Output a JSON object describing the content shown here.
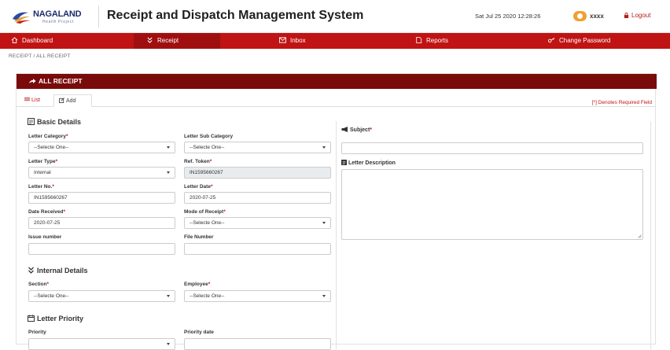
{
  "header": {
    "logo_name": "NAGALAND",
    "logo_sub": "Health Project",
    "title": "Receipt and Dispatch Management System",
    "datetime": "Sat Jul 25 2020 12:28:26",
    "user": "xxxx",
    "logout": "Logout"
  },
  "nav": {
    "items": [
      {
        "label": "Dashboard",
        "icon": "home-icon"
      },
      {
        "label": "Receipt",
        "icon": "chevrons-down-icon"
      },
      {
        "label": "Inbox",
        "icon": "envelope-icon"
      },
      {
        "label": "Reports",
        "icon": "document-icon"
      },
      {
        "label": "Change Password",
        "icon": "key-icon"
      }
    ],
    "active": "Receipt"
  },
  "breadcrumb": "RECEIPT  /  ALL RECEIPT",
  "card": {
    "title": "ALL RECEIPT",
    "tabs": [
      "List",
      "Add"
    ],
    "active_tab": "Add",
    "required_note": "[*] Denotes Required Field"
  },
  "basic_details": {
    "heading": "Basic Details",
    "letter_category": {
      "label": "Letter Category",
      "value": "--Selecte One--"
    },
    "letter_sub_category": {
      "label": "Letter Sub Category",
      "value": "--Selecte One--"
    },
    "letter_type": {
      "label": "Letter Type",
      "value": "Internal"
    },
    "ref_token": {
      "label": "Ref. Token",
      "value": "IN1595660267"
    },
    "letter_no": {
      "label": "Letter No.",
      "value": "IN1595660267"
    },
    "letter_date": {
      "label": "Letter Date",
      "value": "2020-07-25"
    },
    "date_received": {
      "label": "Date Received",
      "value": "2020-07-25"
    },
    "mode_of_receipt": {
      "label": "Mode of Receipt",
      "value": "--Selecte One--"
    },
    "issue_number": {
      "label": "Issue number",
      "value": ""
    },
    "file_number": {
      "label": "File Number",
      "value": ""
    }
  },
  "internal_details": {
    "heading": "Internal Details",
    "section": {
      "label": "Section",
      "value": "--Selecte One--"
    },
    "employee": {
      "label": "Employee",
      "value": "--Selecte One--"
    }
  },
  "letter_priority": {
    "heading": "Letter Priority",
    "priority": {
      "label": "Priority"
    },
    "priority_date": {
      "label": "Priority date"
    }
  },
  "subject": {
    "label": "Subject",
    "value": ""
  },
  "letter_description": {
    "label": "Letter Description",
    "value": ""
  },
  "required_marker": "*",
  "colors": {
    "brand_red": "#c01313",
    "card_header": "#7a0b0b",
    "title_navy": "#1c2d6b"
  }
}
